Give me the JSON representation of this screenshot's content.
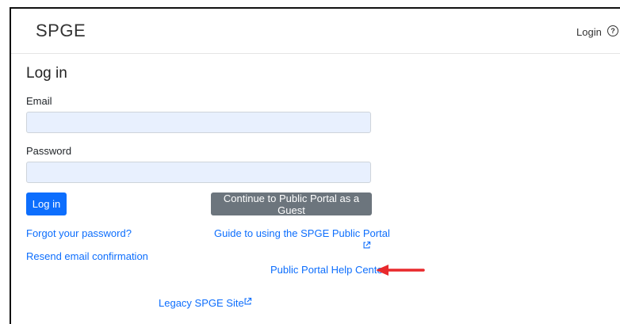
{
  "header": {
    "brand": "SPGE",
    "login_link": "Login",
    "help_glyph": "?"
  },
  "page": {
    "title": "Log in"
  },
  "form": {
    "email_label": "Email",
    "email_value": "",
    "password_label": "Password",
    "password_value": "",
    "login_button": "Log in",
    "guest_button": "Continue to Public Portal as a Guest"
  },
  "links": {
    "forgot_password": "Forgot your password?",
    "resend_confirmation": "Resend email confirmation",
    "guide": "Guide to using the SPGE Public Portal",
    "help_center": "Public Portal Help Center",
    "legacy_site": "Legacy SPGE Site"
  },
  "colors": {
    "link": "#0d6efd",
    "primary_button": "#0d6efd",
    "secondary_button": "#6c757d",
    "input_background": "#e8f0fe",
    "annotation_arrow": "#e8292c"
  },
  "icons": {
    "help": "question-circle-icon",
    "external": "external-link-icon",
    "annotation": "red-arrow-annotation"
  }
}
